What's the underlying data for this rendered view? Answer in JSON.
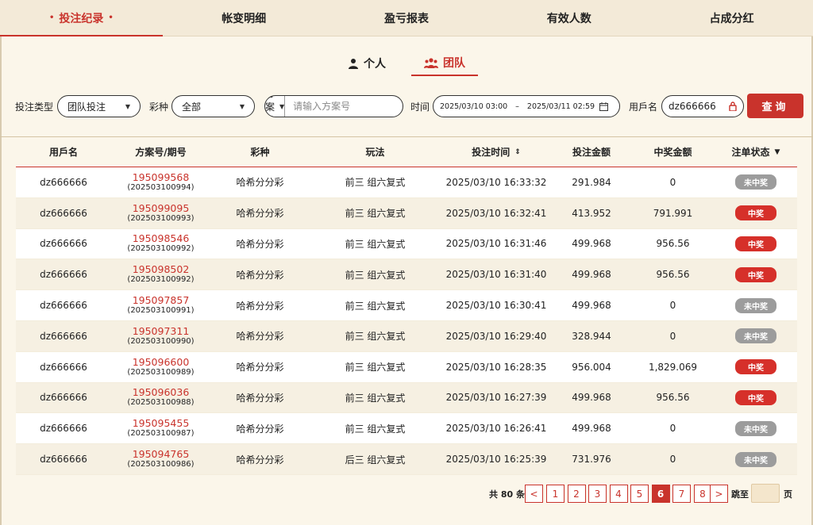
{
  "top_tabs": [
    {
      "label": "投注纪录",
      "active": true
    },
    {
      "label": "帐变明细"
    },
    {
      "label": "盈亏报表"
    },
    {
      "label": "有效人数"
    },
    {
      "label": "占成分红"
    }
  ],
  "tab_dot": "•",
  "scope_switch": {
    "personal": "个人",
    "team": "团队"
  },
  "filters": {
    "bet_type_label": "投注类型",
    "bet_type_value": "团队投注",
    "lottery_label": "彩种",
    "lottery_value": "全部",
    "scheme_select": "方案号",
    "scheme_placeholder": "请输入方案号",
    "time_label": "时间",
    "date_start": "2025/03/10 03:00",
    "date_sep": "–",
    "date_end": "2025/03/11 02:59",
    "username_label": "用戶名",
    "username_value": "dz666666",
    "query_button": "查询"
  },
  "table": {
    "headers": [
      "用戶名",
      "方案号/期号",
      "彩种",
      "玩法",
      "投注时间",
      "投注金额",
      "中奖金额",
      "注单状态"
    ],
    "rows": [
      {
        "user": "dz666666",
        "scheme": "195099568",
        "period": "(202503100994)",
        "lottery": "哈希分分彩",
        "play": "前三 组六复式",
        "time": "2025/03/10 16:33:32",
        "bet": "291.984",
        "win": "0",
        "status": "未中奖"
      },
      {
        "user": "dz666666",
        "scheme": "195099095",
        "period": "(202503100993)",
        "lottery": "哈希分分彩",
        "play": "前三 组六复式",
        "time": "2025/03/10 16:32:41",
        "bet": "413.952",
        "win": "791.991",
        "status": "中奖"
      },
      {
        "user": "dz666666",
        "scheme": "195098546",
        "period": "(202503100992)",
        "lottery": "哈希分分彩",
        "play": "前三 组六复式",
        "time": "2025/03/10 16:31:46",
        "bet": "499.968",
        "win": "956.56",
        "status": "中奖"
      },
      {
        "user": "dz666666",
        "scheme": "195098502",
        "period": "(202503100992)",
        "lottery": "哈希分分彩",
        "play": "前三 组六复式",
        "time": "2025/03/10 16:31:40",
        "bet": "499.968",
        "win": "956.56",
        "status": "中奖"
      },
      {
        "user": "dz666666",
        "scheme": "195097857",
        "period": "(202503100991)",
        "lottery": "哈希分分彩",
        "play": "前三 组六复式",
        "time": "2025/03/10 16:30:41",
        "bet": "499.968",
        "win": "0",
        "status": "未中奖"
      },
      {
        "user": "dz666666",
        "scheme": "195097311",
        "period": "(202503100990)",
        "lottery": "哈希分分彩",
        "play": "前三 组六复式",
        "time": "2025/03/10 16:29:40",
        "bet": "328.944",
        "win": "0",
        "status": "未中奖"
      },
      {
        "user": "dz666666",
        "scheme": "195096600",
        "period": "(202503100989)",
        "lottery": "哈希分分彩",
        "play": "前三 组六复式",
        "time": "2025/03/10 16:28:35",
        "bet": "956.004",
        "win": "1,829.069",
        "status": "中奖"
      },
      {
        "user": "dz666666",
        "scheme": "195096036",
        "period": "(202503100988)",
        "lottery": "哈希分分彩",
        "play": "前三 组六复式",
        "time": "2025/03/10 16:27:39",
        "bet": "499.968",
        "win": "956.56",
        "status": "中奖"
      },
      {
        "user": "dz666666",
        "scheme": "195095455",
        "period": "(202503100987)",
        "lottery": "哈希分分彩",
        "play": "前三 组六复式",
        "time": "2025/03/10 16:26:41",
        "bet": "499.968",
        "win": "0",
        "status": "未中奖"
      },
      {
        "user": "dz666666",
        "scheme": "195094765",
        "period": "(202503100986)",
        "lottery": "哈希分分彩",
        "play": "后三 组六复式",
        "time": "2025/03/10 16:25:39",
        "bet": "731.976",
        "win": "0",
        "status": "未中奖"
      }
    ]
  },
  "pagination": {
    "total": "共 80 条",
    "prev": "<",
    "next": ">",
    "pages": [
      "1",
      "2",
      "3",
      "4",
      "5",
      "6",
      "7",
      "8"
    ],
    "current": "6",
    "jump_label": "跳至",
    "page_unit": "页"
  },
  "icons": {
    "user": "user-icon",
    "team": "team-icon",
    "calendar": "calendar-icon",
    "lock": "lock-icon",
    "sort": "sort-icon",
    "filter": "filter-icon"
  },
  "colors": {
    "accent": "#c9332c",
    "background": "#fbf6ea",
    "status_lose": "#9c9c9c",
    "status_win": "#d6302a"
  }
}
